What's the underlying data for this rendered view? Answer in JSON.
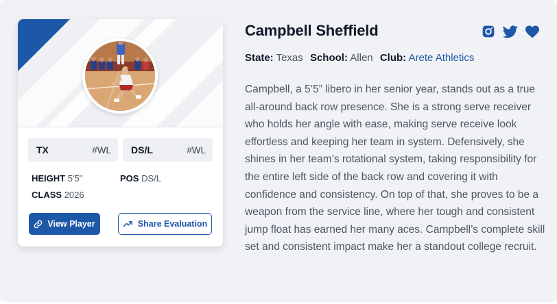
{
  "player": {
    "name": "Campbell Sheffield",
    "state_label": "State:",
    "state": "Texas",
    "school_label": "School:",
    "school": "Allen",
    "club_label": "Club:",
    "club": "Arete Athletics",
    "bio": "Campbell, a 5’5” libero in her senior year, stands out as a true all-around back row presence. She is a strong serve receiver who holds her angle with ease, making serve receive look effortless and keeping her team in system. Defensively, she shines in her team’s rotational system, taking responsibility for the entire left side of the back row and covering it with confidence and consistency. On top of that, she proves to be a weapon from the service line, where her tough and consistent jump float has earned her many aces. Campbell’s complete skill set and consistent impact make her a standout college recruit."
  },
  "card": {
    "state_chip": {
      "code": "TX",
      "rank": "#WL"
    },
    "position_chip": {
      "code": "DS/L",
      "rank": "#WL"
    },
    "stats": {
      "height_label": "HEIGHT",
      "height": "5'5\"",
      "pos_label": "POS",
      "pos": "DS/L",
      "class_label": "CLASS",
      "class": "2026"
    },
    "view_button": "View Player",
    "share_button": "Share Evaluation"
  },
  "icons": {
    "social": [
      "instagram-icon",
      "twitter-icon",
      "heart-icon"
    ],
    "view": "link-icon",
    "share": "trending-up-icon"
  },
  "colors": {
    "accent": "#1d57a8",
    "panel_bg": "#f1f2f5",
    "text": "#4b5563",
    "heading": "#111827"
  }
}
